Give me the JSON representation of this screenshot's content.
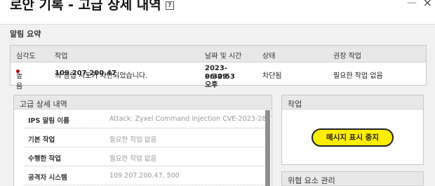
{
  "window": {
    "title": "로안 기록 - 고급 상세 내역",
    "help_icon": "?",
    "close_icon": "×",
    "minimize_icon": "—"
  },
  "alert_summary": {
    "label": "알림 요약",
    "columns": [
      "심각도",
      "작업",
      "날짜 및 시간",
      "상태",
      "권장 작업"
    ],
    "row": {
      "severity": "높음",
      "severity_color": "#c00000",
      "action_ip": "109.207.200.47",
      "action_text": "의 침입 시도가 차단되었습니다.",
      "date_line1": "2023-06-09 오후",
      "date_line2": "9:32:53",
      "status": "차단됨",
      "recommended": "필요한 작업 없음"
    }
  },
  "details": {
    "header": "고급 상세 내역",
    "rows": [
      {
        "label": "IPS 알림 이름",
        "value": "Attack: Zyxel Command Injection CVE-2023-28771"
      },
      {
        "label": "기본 작업",
        "value": "필요한 작업 없음"
      },
      {
        "label": "수행한 작업",
        "value": "필요한 작업 없음"
      },
      {
        "label": "공격자 시스템",
        "value": "109.207.200.47, 500"
      }
    ]
  },
  "actions": {
    "header": "작업",
    "stop_button": "메시지 표시 중지",
    "button_color": "#ffee00"
  },
  "threat": {
    "header": "위협 요소 관리"
  }
}
